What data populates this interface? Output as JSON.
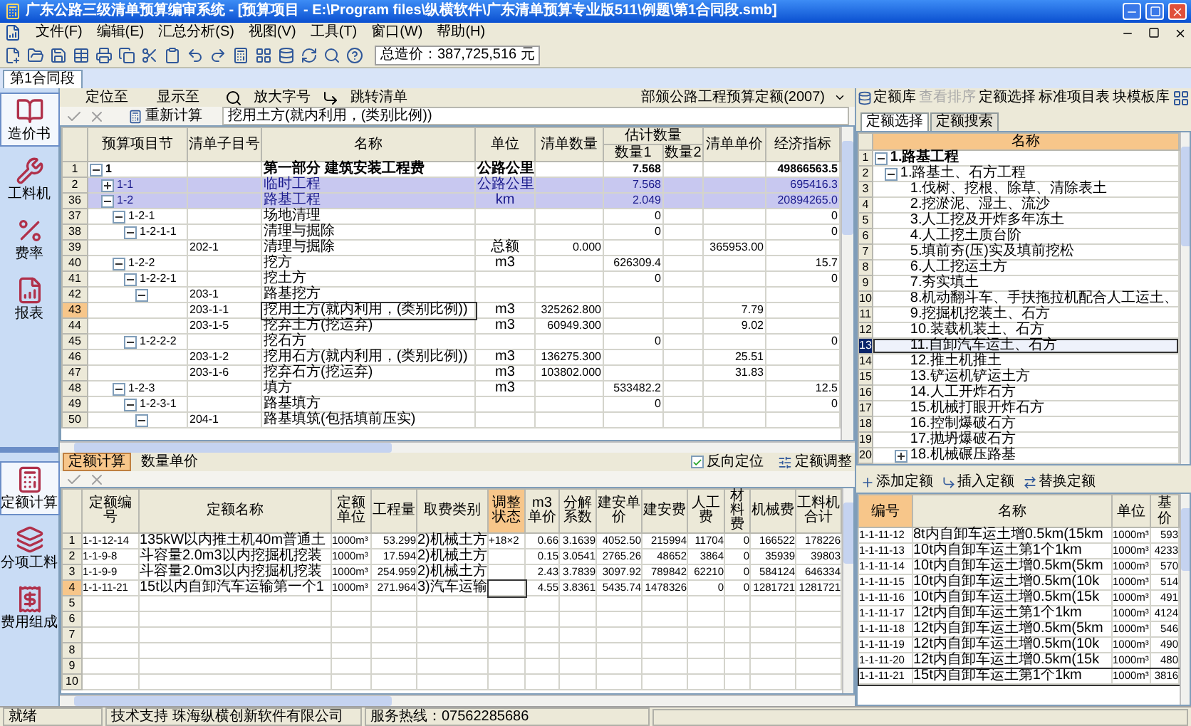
{
  "window": {
    "title": "广东公路三级清单预算编审系统 - [预算项目 - E:\\Program files\\纵横软件\\广东清单预算专业版511\\例题\\第1合同段.smb]"
  },
  "menu": [
    "文件(F)",
    "编辑(E)",
    "汇总分析(S)",
    "视图(V)",
    "工具(T)",
    "窗口(W)",
    "帮助(H)"
  ],
  "toolbar": {
    "total": "总造价：387,725,516 元"
  },
  "doc_tabs": [
    {
      "label": "第1合同段",
      "selected": true
    }
  ],
  "sidebar": {
    "top": [
      {
        "label": "造价书",
        "selected": true
      },
      {
        "label": "工料机",
        "selected": false
      },
      {
        "label": "费率",
        "selected": false
      },
      {
        "label": "报表",
        "selected": false
      }
    ],
    "bottom": [
      {
        "label": "定额计算",
        "selected": true
      },
      {
        "label": "分项工料",
        "selected": false
      },
      {
        "label": "费用组成",
        "selected": false
      }
    ]
  },
  "main_toolbar": {
    "locate": "定位至",
    "show": "显示至",
    "zoom": "放大字号",
    "jump": "跳转清单",
    "quota_db": "部颁公路工程预算定额(2007)",
    "recalc": "重新计算",
    "edit_value": "挖用土方(就内利用，(类别比例))"
  },
  "right_toolbar": [
    {
      "label": "定额库",
      "disabled": false
    },
    {
      "label": "查看排序",
      "disabled": true
    },
    {
      "label": "定额选择",
      "disabled": false
    },
    {
      "label": "标准项目表",
      "disabled": false
    },
    {
      "label": "块模板库",
      "disabled": false
    }
  ],
  "table": {
    "columns": {
      "section": "预算项目节",
      "item": "清单子目号",
      "name": "名称",
      "unit": "单位",
      "qty": "清单数量",
      "est": "估计数量",
      "q1": "数量1",
      "q2": "数量2",
      "price": "清单单价",
      "econ": "经济指标"
    },
    "rows": [
      {
        "row": "1",
        "code": "1",
        "name": "第一部分 建筑安装工程费",
        "unit": "公路公里",
        "q1": "7.568",
        "econ": "49866563.5",
        "expanded": true,
        "selected": false,
        "current": false,
        "children": [
          {
            "row": "2",
            "code": "1-1",
            "name": "临时工程",
            "unit": "公路公里",
            "q1": "7.568",
            "econ": "695416.3",
            "expanded": false,
            "selected": true,
            "current": false
          },
          {
            "row": "36",
            "code": "1-2",
            "name": "路基工程",
            "unit": "km",
            "q1": "2.049",
            "econ": "20894265.0",
            "expanded": true,
            "selected": true,
            "current": false,
            "children": [
              {
                "row": "37",
                "code": "1-2-1",
                "name": "场地清理",
                "q1": "0",
                "econ": "0",
                "expanded": true,
                "selected": false,
                "current": false,
                "children": [
                  {
                    "row": "38",
                    "code": "1-2-1-1",
                    "name": "清理与掘除",
                    "q1": "0",
                    "econ": "0",
                    "expanded": true,
                    "selected": false,
                    "current": false,
                    "children": [
                      {
                        "row": "39",
                        "item": "202-1",
                        "name": "清理与掘除",
                        "unit": "总额",
                        "qty": "0.000",
                        "price": "365953.00",
                        "selected": false,
                        "current": false
                      }
                    ]
                  }
                ]
              },
              {
                "row": "40",
                "code": "1-2-2",
                "name": "挖方",
                "unit": "m3",
                "q1": "626309.4",
                "econ": "15.7",
                "expanded": true,
                "selected": false,
                "current": false,
                "children": [
                  {
                    "row": "41",
                    "code": "1-2-2-1",
                    "name": "挖土方",
                    "q1": "0",
                    "econ": "0",
                    "expanded": true,
                    "selected": false,
                    "current": false,
                    "children": [
                      {
                        "row": "42",
                        "item": "203-1",
                        "name": "路基挖方",
                        "expanded": true,
                        "selected": false,
                        "current": false,
                        "children": [
                          {
                            "row": "43",
                            "item": "203-1-1",
                            "name": "挖用土方(就内利用，(类别比例))",
                            "unit": "m3",
                            "qty": "325262.800",
                            "price": "7.79",
                            "selected": false,
                            "current": true
                          },
                          {
                            "row": "44",
                            "item": "203-1-5",
                            "name": "挖弃土方(挖运弃)",
                            "unit": "m3",
                            "qty": "60949.300",
                            "price": "9.02",
                            "selected": false,
                            "current": false
                          }
                        ]
                      }
                    ]
                  },
                  {
                    "row": "45",
                    "code": "1-2-2-2",
                    "name": "挖石方",
                    "q1": "0",
                    "econ": "0",
                    "expanded": true,
                    "selected": false,
                    "current": false,
                    "children": [
                      {
                        "row": "46",
                        "item": "203-1-2",
                        "name": "挖用石方(就内利用，(类别比例))",
                        "unit": "m3",
                        "qty": "136275.300",
                        "price": "25.51",
                        "selected": false,
                        "current": false
                      },
                      {
                        "row": "47",
                        "item": "203-1-6",
                        "name": "挖弃石方(挖运弃)",
                        "unit": "m3",
                        "qty": "103802.000",
                        "price": "31.83",
                        "selected": false,
                        "current": false
                      }
                    ]
                  }
                ]
              },
              {
                "row": "48",
                "code": "1-2-3",
                "name": "填方",
                "unit": "m3",
                "q1": "533482.2",
                "econ": "12.5",
                "expanded": true,
                "selected": false,
                "current": false,
                "children": [
                  {
                    "row": "49",
                    "code": "1-2-3-1",
                    "name": "路基填方",
                    "q1": "0",
                    "econ": "0",
                    "expanded": true,
                    "selected": false,
                    "current": false,
                    "children": [
                      {
                        "row": "50",
                        "item": "204-1",
                        "name": "路基填筑(包括填前压实)",
                        "expanded": true,
                        "selected": false,
                        "current": false
                      }
                    ]
                  }
                ]
              }
            ]
          }
        ]
      }
    ]
  },
  "bottom_tabs": [
    {
      "label": "定额计算",
      "selected": true
    },
    {
      "label": "数量单价",
      "selected": false
    }
  ],
  "reverse_locate": {
    "label": "反向定位",
    "checked": true
  },
  "adjust_button": "定额调整",
  "quota_table": {
    "columns": [
      {
        "label": "定额编号",
        "selected": false
      },
      {
        "label": "定额名称",
        "selected": false
      },
      {
        "label": "定额单位",
        "selected": false
      },
      {
        "label": "工程量",
        "selected": false
      },
      {
        "label": "取费类别",
        "selected": false
      },
      {
        "label": "调整状态",
        "selected": true
      },
      {
        "label": "m3单价",
        "selected": false
      },
      {
        "label": "分解系数",
        "selected": false
      },
      {
        "label": "建安单价",
        "selected": false
      },
      {
        "label": "建安费",
        "selected": false
      },
      {
        "label": "人工费",
        "selected": false
      },
      {
        "label": "材料费",
        "selected": false
      },
      {
        "label": "机械费",
        "selected": false
      },
      {
        "label": "工料机合计",
        "selected": false
      }
    ],
    "rows": [
      {
        "row": "1",
        "cells": [
          "1-1-12-14",
          "135kW以内推土机40m普通土",
          "1000m³",
          "53.299",
          "2)机械土方",
          "+18×2",
          "0.66",
          "3.1639",
          "4052.50",
          "215994",
          "11704",
          "0",
          "166522",
          "178226"
        ],
        "current": false
      },
      {
        "row": "2",
        "cells": [
          "1-1-9-8",
          "斗容量2.0m3以内挖掘机挖装",
          "1000m³",
          "17.594",
          "2)机械土方",
          "",
          "0.15",
          "3.0541",
          "2765.26",
          "48652",
          "3864",
          "0",
          "35939",
          "39803"
        ],
        "current": false
      },
      {
        "row": "3",
        "cells": [
          "1-1-9-9",
          "斗容量2.0m3以内挖掘机挖装",
          "1000m³",
          "254.959",
          "2)机械土方",
          "",
          "2.43",
          "3.7839",
          "3097.92",
          "789842",
          "62210",
          "0",
          "584124",
          "646334"
        ],
        "current": false
      },
      {
        "row": "4",
        "cells": [
          "1-1-11-21",
          "15t以内自卸汽车运输第一个1",
          "1000m³",
          "271.964",
          "3)汽车运输",
          "",
          "4.55",
          "3.8361",
          "5435.74",
          "1478326",
          "0",
          "0",
          "1281721",
          "1281721"
        ],
        "current": true
      },
      {
        "row": "5",
        "current": false
      },
      {
        "row": "6",
        "current": false
      },
      {
        "row": "7",
        "current": false
      },
      {
        "row": "8",
        "current": false
      },
      {
        "row": "9",
        "current": false
      },
      {
        "row": "10",
        "current": false
      }
    ]
  },
  "quota_tabs": [
    {
      "label": "定额选择",
      "selected": true
    },
    {
      "label": "定额搜索",
      "selected": false
    }
  ],
  "quota_tree": {
    "column": {
      "label": "名称",
      "selected": true
    },
    "rows": [
      {
        "row": "1",
        "name": "1.路基工程",
        "expanded": true,
        "selected": false,
        "children": [
          {
            "row": "2",
            "name": "1.路基土、石方工程",
            "expanded": true,
            "selected": false,
            "children": [
              {
                "row": "3",
                "name": "1.伐树、挖根、除草、清除表土",
                "selected": false
              },
              {
                "row": "4",
                "name": "2.挖淤泥、湿土、流沙",
                "selected": false
              },
              {
                "row": "5",
                "name": "3.人工挖及开炸多年冻土",
                "selected": false
              },
              {
                "row": "6",
                "name": "4.人工挖土质台阶",
                "selected": false
              },
              {
                "row": "7",
                "name": "5.填前夯(压)实及填前挖松",
                "selected": false
              },
              {
                "row": "8",
                "name": "6.人工挖运土方",
                "selected": false
              },
              {
                "row": "9",
                "name": "7.夯实填土",
                "selected": false
              },
              {
                "row": "10",
                "name": "8.机动翻斗车、手扶拖拉机配合人工运土、",
                "selected": false
              },
              {
                "row": "11",
                "name": "9.挖掘机挖装土、石方",
                "selected": false
              },
              {
                "row": "12",
                "name": "10.装载机装土、石方",
                "selected": false
              },
              {
                "row": "13",
                "name": "11.自卸汽车运土、石方",
                "selected": true
              },
              {
                "row": "14",
                "name": "12.推土机推土",
                "selected": false
              },
              {
                "row": "15",
                "name": "13.铲运机铲运土方",
                "selected": false
              },
              {
                "row": "16",
                "name": "14.人工开炸石方",
                "selected": false
              },
              {
                "row": "17",
                "name": "15.机械打眼开炸石方",
                "selected": false
              },
              {
                "row": "18",
                "name": "16.控制爆破石方",
                "selected": false
              },
              {
                "row": "19",
                "name": "17.抛坍爆破石方",
                "selected": false
              },
              {
                "row": "20",
                "name": "18.机械碾压路基",
                "expanded": false,
                "selected": false
              }
            ]
          }
        ]
      }
    ]
  },
  "quota_actions": [
    "添加定额",
    "插入定额",
    "替换定额"
  ],
  "quota_list": {
    "columns": [
      {
        "label": "编号",
        "selected": true
      },
      {
        "label": "名称",
        "selected": false
      },
      {
        "label": "单位",
        "selected": false
      },
      {
        "label": "基价",
        "selected": false
      }
    ],
    "rows": [
      {
        "cells": [
          "1-1-11-12",
          "8t内自卸车运土增0.5km(15km",
          "1000m³",
          "593"
        ],
        "selected": false
      },
      {
        "cells": [
          "1-1-11-13",
          "10t内自卸车运土第1个1km",
          "1000m³",
          "4233"
        ],
        "selected": false
      },
      {
        "cells": [
          "1-1-11-14",
          "10t内自卸车运土增0.5km(5km",
          "1000m³",
          "570"
        ],
        "selected": false
      },
      {
        "cells": [
          "1-1-11-15",
          "10t内自卸车运土增0.5km(10k",
          "1000m³",
          "514"
        ],
        "selected": false
      },
      {
        "cells": [
          "1-1-11-16",
          "10t内自卸车运土增0.5km(15k",
          "1000m³",
          "491"
        ],
        "selected": false
      },
      {
        "cells": [
          "1-1-11-17",
          "12t内自卸车运土第1个1km",
          "1000m³",
          "4124"
        ],
        "selected": false
      },
      {
        "cells": [
          "1-1-11-18",
          "12t内自卸车运土增0.5km(5km",
          "1000m³",
          "546"
        ],
        "selected": false
      },
      {
        "cells": [
          "1-1-11-19",
          "12t内自卸车运土增0.5km(10k",
          "1000m³",
          "490"
        ],
        "selected": false
      },
      {
        "cells": [
          "1-1-11-20",
          "12t内自卸车运土增0.5km(15k",
          "1000m³",
          "480"
        ],
        "selected": false
      },
      {
        "cells": [
          "1-1-11-21",
          "15t内自卸车运土第1个1km",
          "1000m³",
          "3816"
        ],
        "selected": true
      }
    ]
  },
  "status_bar": [
    "就绪",
    "技术支持 珠海纵横创新软件有限公司",
    "服务热线：07562285686"
  ]
}
